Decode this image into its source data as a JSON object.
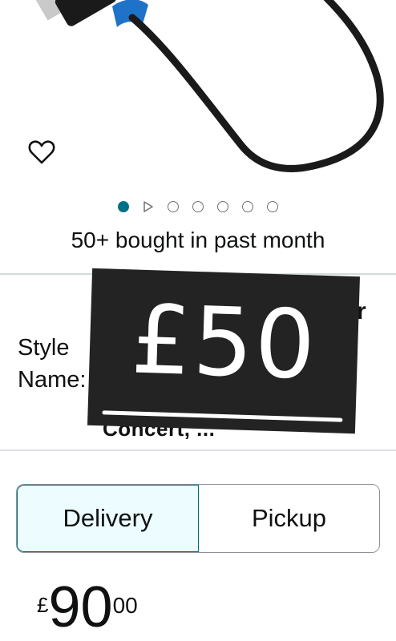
{
  "product": {
    "image_alt": "product-photo",
    "wishlist_icon": "heart-outline-icon"
  },
  "carousel": {
    "slides": [
      "image",
      "video",
      "image",
      "image",
      "image",
      "image",
      "image"
    ],
    "active_index": 0
  },
  "social_proof": "50+ bought in past month",
  "style": {
    "label": "Style Name:",
    "partial_value_top": "r",
    "partial_value_bottom": "Concert, ..."
  },
  "sticker": {
    "text": "£50"
  },
  "fulfillment": {
    "options": [
      "Delivery",
      "Pickup"
    ],
    "selected": "Delivery"
  },
  "price": {
    "symbol": "£",
    "whole": "90",
    "fraction": "00"
  },
  "colors": {
    "accent": "#007185",
    "selected_bg": "#edfdff",
    "text": "#0f1111",
    "cable_blue": "#1e73c8"
  }
}
